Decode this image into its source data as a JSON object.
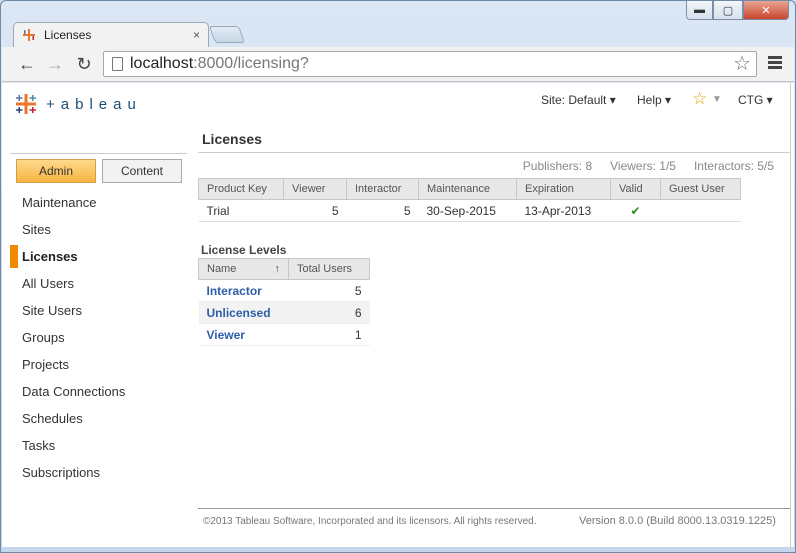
{
  "browser": {
    "tab_title": "Licenses",
    "tab_close": "×",
    "url_host": "localhost",
    "url_path": ":8000/licensing?",
    "window_controls": {
      "minimize": "▬",
      "maximize": "▢",
      "close": "✕"
    }
  },
  "header": {
    "logo_text": "+ableau",
    "site_menu": "Site: Default ▾",
    "help_menu": "Help ▾",
    "favorites_icon": "star-icon",
    "user_menu": "CTG ▾"
  },
  "side": {
    "tabs": {
      "admin": "Admin",
      "content": "Content"
    },
    "items": [
      "Maintenance",
      "Sites",
      "Licenses",
      "All Users",
      "Site Users",
      "Groups",
      "Projects",
      "Data Connections",
      "Schedules",
      "Tasks",
      "Subscriptions"
    ],
    "active_index": 2
  },
  "main": {
    "title": "Licenses",
    "stats": {
      "publishers": "Publishers: 8",
      "viewers": "Viewers: 1/5",
      "interactors": "Interactors: 5/5"
    },
    "license_table": {
      "headers": [
        "Product Key",
        "Viewer",
        "Interactor",
        "Maintenance",
        "Expiration",
        "Valid",
        "Guest User"
      ],
      "rows": [
        [
          "Trial",
          "5",
          "5",
          "30-Sep-2015",
          "13-Apr-2013",
          "✔",
          ""
        ]
      ]
    },
    "levels": {
      "title": "License Levels",
      "headers": [
        "Name",
        "Total Users"
      ],
      "sort_indicator": "↑",
      "rows": [
        [
          "Interactor",
          "5"
        ],
        [
          "Unlicensed",
          "6"
        ],
        [
          "Viewer",
          "1"
        ]
      ]
    }
  },
  "footer": {
    "copyright": "©2013 Tableau Software, Incorporated and its licensors. All rights reserved.",
    "version": "Version 8.0.0 (Build 8000.13.0319.1225)"
  },
  "colors": {
    "accent": "#f08a00",
    "link": "#2e5ea8",
    "check": "#2d8a1f"
  }
}
